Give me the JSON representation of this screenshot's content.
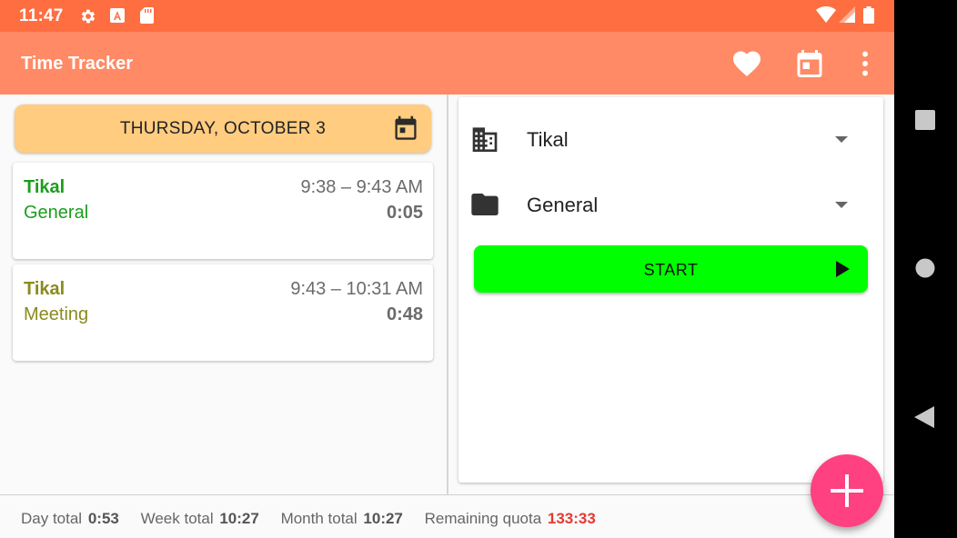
{
  "status_bar": {
    "time": "11:47",
    "icons": [
      "settings-icon",
      "a-notification-icon",
      "sd-card-icon",
      "wifi-icon",
      "signal-icon",
      "battery-icon"
    ]
  },
  "app_bar": {
    "title": "Time Tracker",
    "actions": [
      "favorite-icon",
      "calendar-icon",
      "more-vert-icon"
    ]
  },
  "colors": {
    "status_bar": "#ff6e40",
    "app_bar": "#ff8a65",
    "date_bar": "#ffcc80",
    "start_button": "#00ff00",
    "fab": "#ff4081",
    "quota": "#e53935"
  },
  "date_bar": {
    "label": "THURSDAY, OCTOBER 3",
    "icon": "calendar-icon"
  },
  "entries": [
    {
      "project": "Tikal",
      "task": "General",
      "time_range": "9:38 – 9:43 AM",
      "duration": "0:05",
      "color": "#1b9e1b"
    },
    {
      "project": "Tikal",
      "task": "Meeting",
      "time_range": "9:43 – 10:31 AM",
      "duration": "0:48",
      "color": "#8a8a1e"
    }
  ],
  "selectors": {
    "project": {
      "value": "Tikal",
      "icon": "building-icon"
    },
    "task": {
      "value": "General",
      "icon": "folder-icon"
    }
  },
  "start_button": {
    "label": "START",
    "icon": "play-icon"
  },
  "footer": {
    "day_total_label": "Day total",
    "day_total_value": "0:53",
    "week_total_label": "Week total",
    "week_total_value": "10:27",
    "month_total_label": "Month total",
    "month_total_value": "10:27",
    "remaining_quota_label": "Remaining quota",
    "remaining_quota_value": "133:33"
  },
  "fab": {
    "icon": "plus-icon"
  },
  "nav_bar": {
    "buttons": [
      "recents-icon",
      "home-icon",
      "back-icon"
    ]
  }
}
